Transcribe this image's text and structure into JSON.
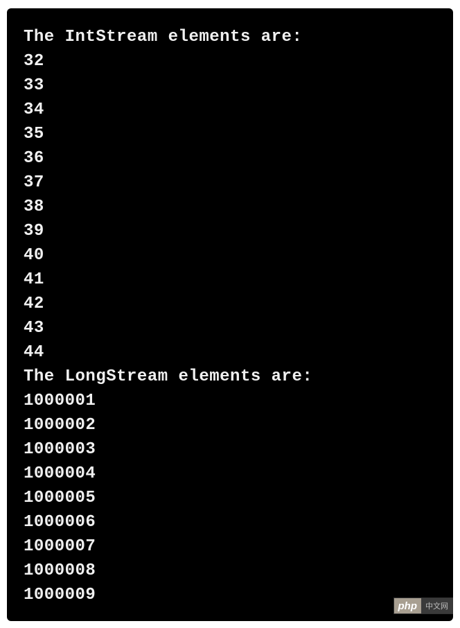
{
  "terminal": {
    "header_int": "The IntStream elements are:",
    "int_values": [
      "32",
      "33",
      "34",
      "35",
      "36",
      "37",
      "38",
      "39",
      "40",
      "41",
      "42",
      "43",
      "44"
    ],
    "header_long": "The LongStream elements are:",
    "long_values": [
      "1000001",
      "1000002",
      "1000003",
      "1000004",
      "1000005",
      "1000006",
      "1000007",
      "1000008",
      "1000009"
    ]
  },
  "watermark": {
    "left": "php",
    "right": "中文网"
  }
}
